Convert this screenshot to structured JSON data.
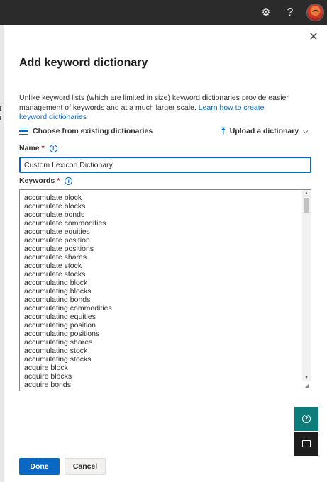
{
  "header": {
    "settings_icon": "gear-icon",
    "help_glyph": "?",
    "avatar": "user-avatar"
  },
  "panel": {
    "close_glyph": "✕",
    "title": "Add keyword dictionary",
    "description_text": "Unlike keyword lists (which are limited in size) keyword dictionaries provide easier management of keywords and at a much larger scale. ",
    "description_link": "Learn how to create keyword dictionaries",
    "choose_label": "Choose from existing dictionaries",
    "upload_label": "Upload a dictionary",
    "name_label": "Name",
    "name_value": "Custom Lexicon Dictionary",
    "keywords_label": "Keywords",
    "required_mark": "*",
    "info_glyph": "i",
    "keywords": [
      "accumulate block",
      "accumulate blocks",
      "accumulate bonds",
      "accumulate commodities",
      "accumulate equities",
      "accumulate position",
      "accumulate positions",
      "accumulate shares",
      "accumulate stock",
      "accumulate stocks",
      "accumulating block",
      "accumulating blocks",
      "accumulating bonds",
      "accumulating commodities",
      "accumulating equities",
      "accumulating position",
      "accumulating positions",
      "accumulating shares",
      "accumulating stock",
      "accumulating stocks",
      "acquire block",
      "acquire blocks",
      "acquire bonds"
    ]
  },
  "footer": {
    "done_label": "Done",
    "cancel_label": "Cancel"
  },
  "colors": {
    "accent": "#0a67c2",
    "topbar": "#2b2b2b",
    "fab_teal": "#0f7c7c"
  }
}
